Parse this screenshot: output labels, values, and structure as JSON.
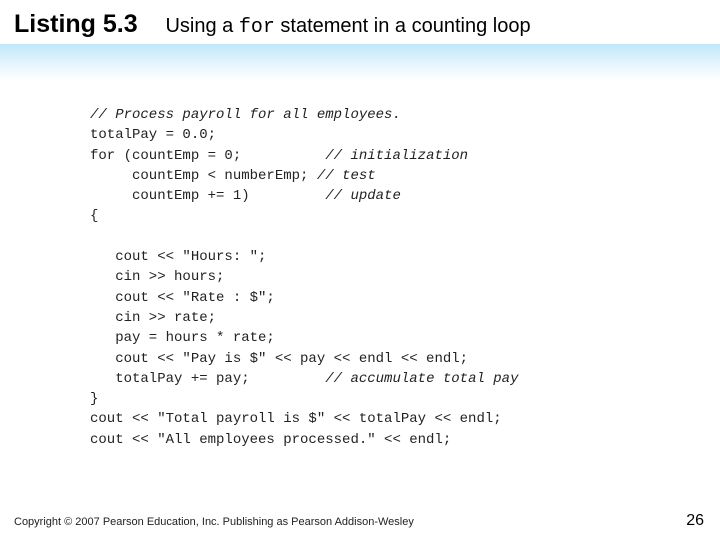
{
  "heading": {
    "listing": "Listing 5.3",
    "prefix": "Using a ",
    "keyword": "for",
    "suffix": " statement in a counting loop"
  },
  "code": {
    "c01": "// Process payroll for all employees.",
    "l02": "totalPay = 0.0;",
    "l03a": "for (countEmp = 0;          ",
    "c03b": "// initialization",
    "l04a": "     countEmp < numberEmp; ",
    "c04b": "// test",
    "l05a": "     countEmp += 1)         ",
    "c05b": "// update",
    "l06": "{",
    "l07": "",
    "l08": "   cout << \"Hours: \";",
    "l09": "   cin >> hours;",
    "l10": "   cout << \"Rate : $\";",
    "l11": "   cin >> rate;",
    "l12": "   pay = hours * rate;",
    "l13": "   cout << \"Pay is $\" << pay << endl << endl;",
    "l14a": "   totalPay += pay;         ",
    "c14b": "// accumulate total pay",
    "l15": "}",
    "l16": "cout << \"Total payroll is $\" << totalPay << endl;",
    "l17": "cout << \"All employees processed.\" << endl;"
  },
  "footer": {
    "copyright": "Copyright © 2007 Pearson Education, Inc. Publishing as Pearson Addison-Wesley",
    "page": "26"
  }
}
